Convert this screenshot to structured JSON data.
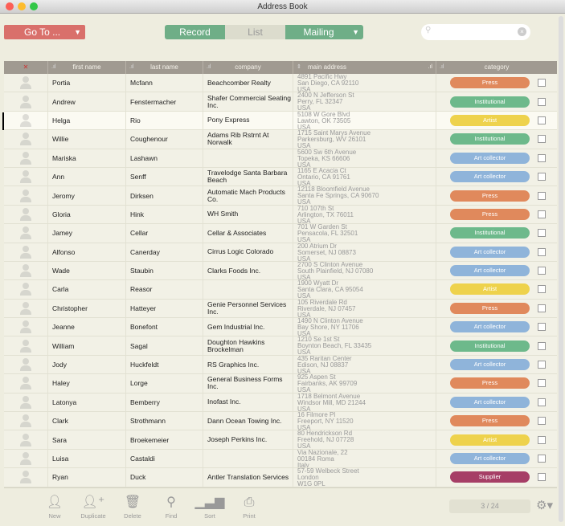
{
  "window": {
    "title": "Address Book"
  },
  "toolbar": {
    "goto": "Go To ...",
    "record": "Record",
    "list": "List",
    "mailing": "Mailing",
    "search_placeholder": ""
  },
  "columns": [
    "first name",
    "last name",
    "company",
    "main address",
    "category"
  ],
  "category_colors": {
    "Press": "#e0895c",
    "Institutional": "#6db98b",
    "Artist": "#eed24c",
    "Art collector": "#8fb4da",
    "Supplier": "#a63e66"
  },
  "rows": [
    {
      "first": "Portia",
      "last": "Mcfann",
      "company": "Beachcomber Realty",
      "address": [
        "4891 Pacific Hwy",
        "San Diego, CA 92110",
        "USA"
      ],
      "category": "Press"
    },
    {
      "first": "Andrew",
      "last": "Fenstermacher",
      "company": "Shafer Commercial Seating Inc.",
      "address": [
        "2400 N Jefferson St",
        "Perry, FL 32347",
        "USA"
      ],
      "category": "Institutional"
    },
    {
      "first": "Helga",
      "last": "Rio",
      "company": "Pony Express",
      "address": [
        "5108 W Gore Blvd",
        "Lawton, OK 73505",
        "USA"
      ],
      "category": "Artist",
      "selected": true
    },
    {
      "first": "Willie",
      "last": "Coughenour",
      "company": "Adams Rib Rstrnt At Norwalk",
      "address": [
        "1715 Saint Marys Avenue",
        "Parkersburg, WV 26101",
        "USA"
      ],
      "category": "Institutional"
    },
    {
      "first": "Mariska",
      "last": "Lashawn",
      "company": "",
      "address": [
        "5600 Sw 6th Avenue",
        "Topeka, KS 66606",
        "USA"
      ],
      "category": "Art collector"
    },
    {
      "first": "Ann",
      "last": "Senff",
      "company": "Travelodge Santa Barbara Beach",
      "address": [
        "1165 E Acacia Ct",
        "Ontario, CA 91761",
        "USA"
      ],
      "category": "Art collector"
    },
    {
      "first": "Jeromy",
      "last": "Dirksen",
      "company": "Automatic Mach Products Co.",
      "address": [
        "12118 Bloomfield Avenue",
        "Santa Fe Springs, CA 90670",
        "USA"
      ],
      "category": "Press"
    },
    {
      "first": "Gloria",
      "last": "Hink",
      "company": "WH Smith",
      "address": [
        "710 107th St",
        "Arlington, TX 76011",
        "USA"
      ],
      "category": "Press"
    },
    {
      "first": "Jamey",
      "last": "Cellar",
      "company": "Cellar & Associates",
      "address": [
        "701 W Garden St",
        "Pensacola, FL 32501",
        "USA"
      ],
      "category": "Institutional"
    },
    {
      "first": "Alfonso",
      "last": "Canerday",
      "company": "Cirrus Logic Colorado",
      "address": [
        "200 Atrium Dr",
        "Somerset, NJ 08873",
        "USA"
      ],
      "category": "Art collector"
    },
    {
      "first": "Wade",
      "last": "Staubin",
      "company": "Clarks Foods Inc.",
      "address": [
        "2700 S Clinton Avenue",
        "South Plainfield, NJ 07080",
        "USA"
      ],
      "category": "Art collector"
    },
    {
      "first": "Carla",
      "last": "Reasor",
      "company": "",
      "address": [
        "1900 Wyatt Dr",
        "Santa Clara, CA 95054",
        "USA"
      ],
      "category": "Artist"
    },
    {
      "first": "Christopher",
      "last": "Hatteyer",
      "company": "Genie Personnel Services Inc.",
      "address": [
        "105 Riverdale Rd",
        "Riverdale, NJ 07457",
        "USA"
      ],
      "category": "Press"
    },
    {
      "first": "Jeanne",
      "last": "Bonefont",
      "company": "Gem Industrial Inc.",
      "address": [
        "1490 N Clinton Avenue",
        "Bay Shore, NY 11706",
        "USA"
      ],
      "category": "Art collector"
    },
    {
      "first": "William",
      "last": "Sagal",
      "company": "Doughton Hawkins Brockelman",
      "address": [
        "1210 Se 1st St",
        "Boynton Beach, FL 33435",
        "USA"
      ],
      "category": "Institutional"
    },
    {
      "first": "Jody",
      "last": "Huckfeldt",
      "company": "RS Graphics Inc.",
      "address": [
        "435 Raritan Center",
        "Edison, NJ 08837",
        "USA"
      ],
      "category": "Art collector"
    },
    {
      "first": "Haley",
      "last": "Lorge",
      "company": "General Business Forms Inc.",
      "address": [
        "925 Aspen St",
        "Fairbanks, AK 99709",
        "USA"
      ],
      "category": "Press"
    },
    {
      "first": "Latonya",
      "last": "Bemberry",
      "company": "Inofast Inc.",
      "address": [
        "1718 Belmont Avenue",
        "Windsor Mill, MD 21244",
        "USA"
      ],
      "category": "Art collector"
    },
    {
      "first": "Clark",
      "last": "Strothmann",
      "company": "Dann Ocean Towing Inc.",
      "address": [
        "16 Filmore Pl",
        "Freeport, NY 11520",
        "USA"
      ],
      "category": "Press"
    },
    {
      "first": "Sara",
      "last": "Broekemeier",
      "company": "Joseph Perkins Inc.",
      "address": [
        "80 Hendrickson Rd",
        "Freehold, NJ 07728",
        "USA"
      ],
      "category": "Artist"
    },
    {
      "first": "Luisa",
      "last": "Castaldi",
      "company": "",
      "address": [
        "Via Nazionale, 22",
        "00184 Roma",
        "Italy"
      ],
      "category": "Art collector"
    },
    {
      "first": "Ryan",
      "last": "Duck",
      "company": "Antler Translation Services",
      "address": [
        "57-59 Welbeck Street",
        "London",
        "W1G 0PL"
      ],
      "category": "Supplier"
    }
  ],
  "footer": {
    "new": "New",
    "duplicate": "Duplicate",
    "delete": "Delete",
    "find": "Find",
    "sort": "Sort",
    "print": "Print",
    "pager": "3 / 24"
  }
}
